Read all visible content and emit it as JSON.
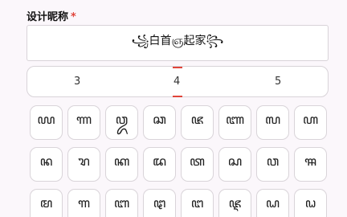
{
  "form": {
    "label": "设计昵称",
    "required_mark": "*",
    "nickname_value": "꧁白首ஞ起家꧂"
  },
  "pager": {
    "pages": [
      "3",
      "4",
      "5"
    ],
    "selected": "4"
  },
  "symbol_keys": [
    "ꦪ",
    "ꦟ",
    "ꦎ",
    "ꦕ",
    "ꦗ",
    "ꦚ",
    "ꦭ",
    "ꦲ",
    "ꦤ",
    "ꦫ",
    "ꦏ",
    "ꦢ",
    "ꦠ",
    "ꦱ",
    "ꦮ",
    "ꦯ",
    "ꦩ",
    "ꦒ",
    "ꦧ",
    "ꦛ",
    "ꦔ",
    "ꦘ",
    "ꦝ",
    "ꦞ"
  ]
}
